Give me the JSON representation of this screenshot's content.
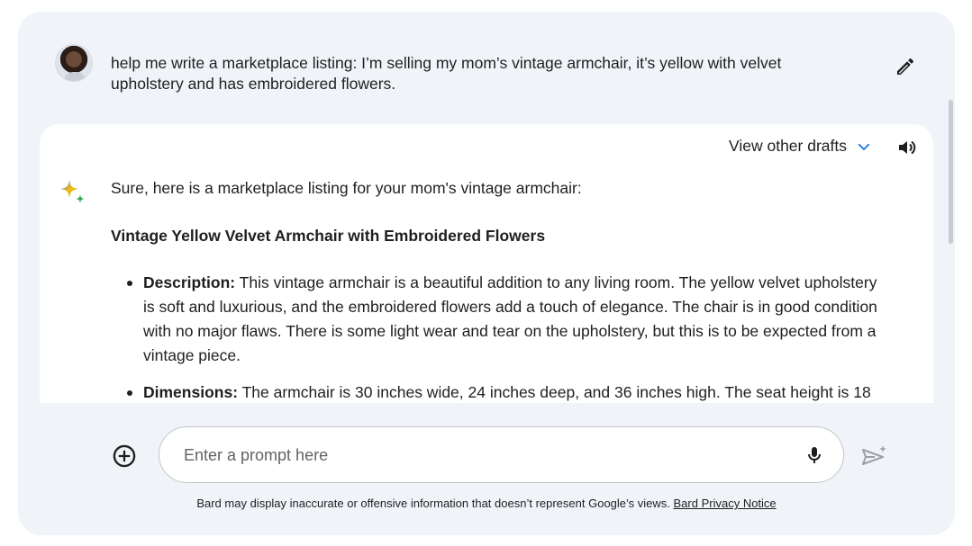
{
  "user": {
    "prompt": "help me write a marketplace listing: I’m selling my mom’s vintage armchair, it’s yellow with velvet upholstery and has embroidered flowers."
  },
  "response": {
    "drafts_label": "View other drafts",
    "intro": "Sure, here is a marketplace listing for your mom's vintage armchair:",
    "title": "Vintage Yellow Velvet Armchair with Embroidered Flowers",
    "items": [
      {
        "label": "Description:",
        "text": " This vintage armchair is a beautiful addition to any living room. The yellow velvet upholstery is soft and luxurious, and the embroidered flowers add a touch of elegance. The chair is in good condition with no major flaws. There is some light wear and tear on the upholstery, but this is to be expected from a vintage piece."
      },
      {
        "label": "Dimensions:",
        "text": " The armchair is 30 inches wide, 24 inches deep, and 36 inches high. The seat height is 18"
      }
    ]
  },
  "input": {
    "placeholder": "Enter a prompt here",
    "value": ""
  },
  "footer": {
    "disclaimer": "Bard may display inaccurate or offensive information that doesn’t represent Google’s views. ",
    "link": "Bard Privacy Notice"
  },
  "colors": {
    "background": "#f0f4f9",
    "accent": "#1a73e8",
    "sparkle_blue": "#4285f4",
    "sparkle_yellow": "#fbbc04",
    "sparkle_green": "#34a853"
  },
  "icons": {
    "edit": "pencil-icon",
    "drafts": "chevron-down-icon",
    "speaker": "speaker-icon",
    "assistant": "sparkle-icon",
    "add": "add-circle-icon",
    "mic": "mic-icon",
    "send": "send-icon"
  }
}
